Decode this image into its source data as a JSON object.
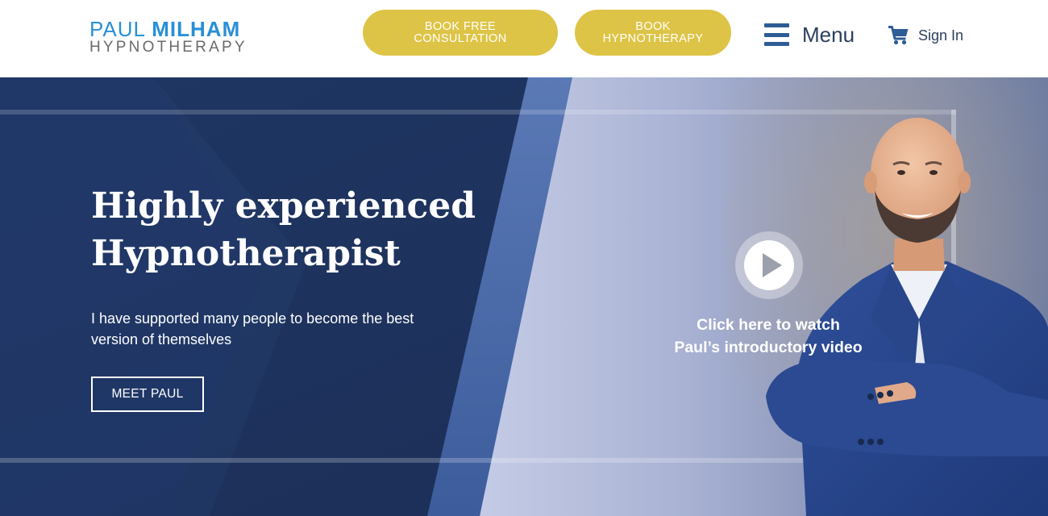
{
  "header": {
    "logo": {
      "name_first": "PAUL",
      "name_last": "MILHAM",
      "tagline": "HYPNOTHERAPY"
    },
    "consultation_button": {
      "line1": "BOOK FREE",
      "line2": "CONSULTATION"
    },
    "hypnotherapy_button": {
      "line1": "BOOK",
      "line2": "HYPNOTHERAPY"
    },
    "menu_label": "Menu",
    "signin_label": "Sign In"
  },
  "hero": {
    "title_line1": "Highly experienced",
    "title_line2": "Hypnotherapist",
    "subtitle": "I have supported many people to become the best version of themselves",
    "cta_label": "MEET PAUL",
    "video_caption_line1": "Click here to watch",
    "video_caption_line2": "Paul’s introductory video"
  },
  "colors": {
    "brand_blue": "#2a8fd6",
    "button_gold": "#ddc446",
    "hero_navy": "#1e335e",
    "text_dark": "#2b3f5c"
  },
  "icons": [
    "hamburger-icon",
    "cart-icon",
    "play-icon"
  ]
}
